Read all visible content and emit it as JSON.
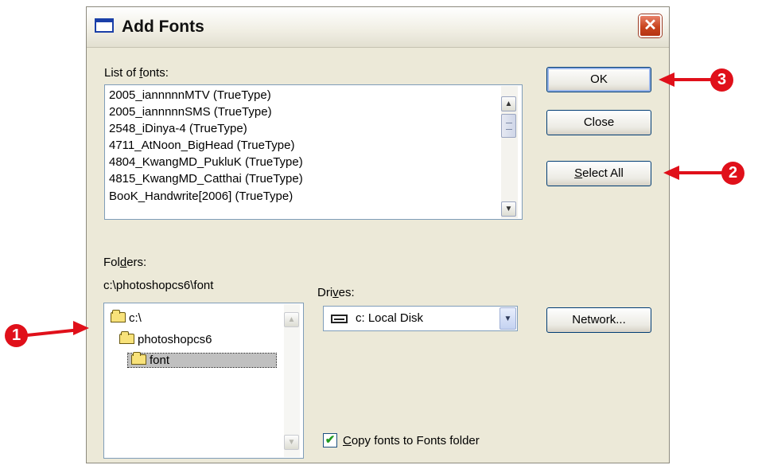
{
  "dialog": {
    "title": "Add Fonts",
    "close_symbol": "✕"
  },
  "fonts_list": {
    "label_pre": "List of ",
    "label_accel": "f",
    "label_post": "onts:",
    "items": [
      "2005_iannnnnMTV (TrueType)",
      "2005_iannnnnSMS (TrueType)",
      "2548_iDinya-4 (TrueType)",
      "4711_AtNoon_BigHead (TrueType)",
      "4804_KwangMD_PukluK (TrueType)",
      "4815_KwangMD_Catthai (TrueType)",
      "BooK_Handwrite[2006] (TrueType)"
    ]
  },
  "buttons": {
    "ok": "OK",
    "close": "Close",
    "select_all_accel": "S",
    "select_all_rest": "elect All",
    "network": "Network..."
  },
  "folders": {
    "label_pre": "Fol",
    "label_accel": "d",
    "label_post": "ers:",
    "current_path": "c:\\photoshopcs6\\font",
    "tree": [
      "c:\\",
      "photoshopcs6",
      "font"
    ]
  },
  "drives": {
    "label_pre": "Dri",
    "label_accel": "v",
    "label_post": "es:",
    "selected": "c: Local Disk"
  },
  "copy_option": {
    "checked": true,
    "check_mark": "✔",
    "label_accel": "C",
    "label_rest": "opy fonts to Fonts folder"
  },
  "annotations": {
    "step1": "1",
    "step2": "2",
    "step3": "3",
    "color": "#e0101a"
  },
  "icons": {
    "scroll_up": "▲",
    "scroll_down": "▼"
  }
}
